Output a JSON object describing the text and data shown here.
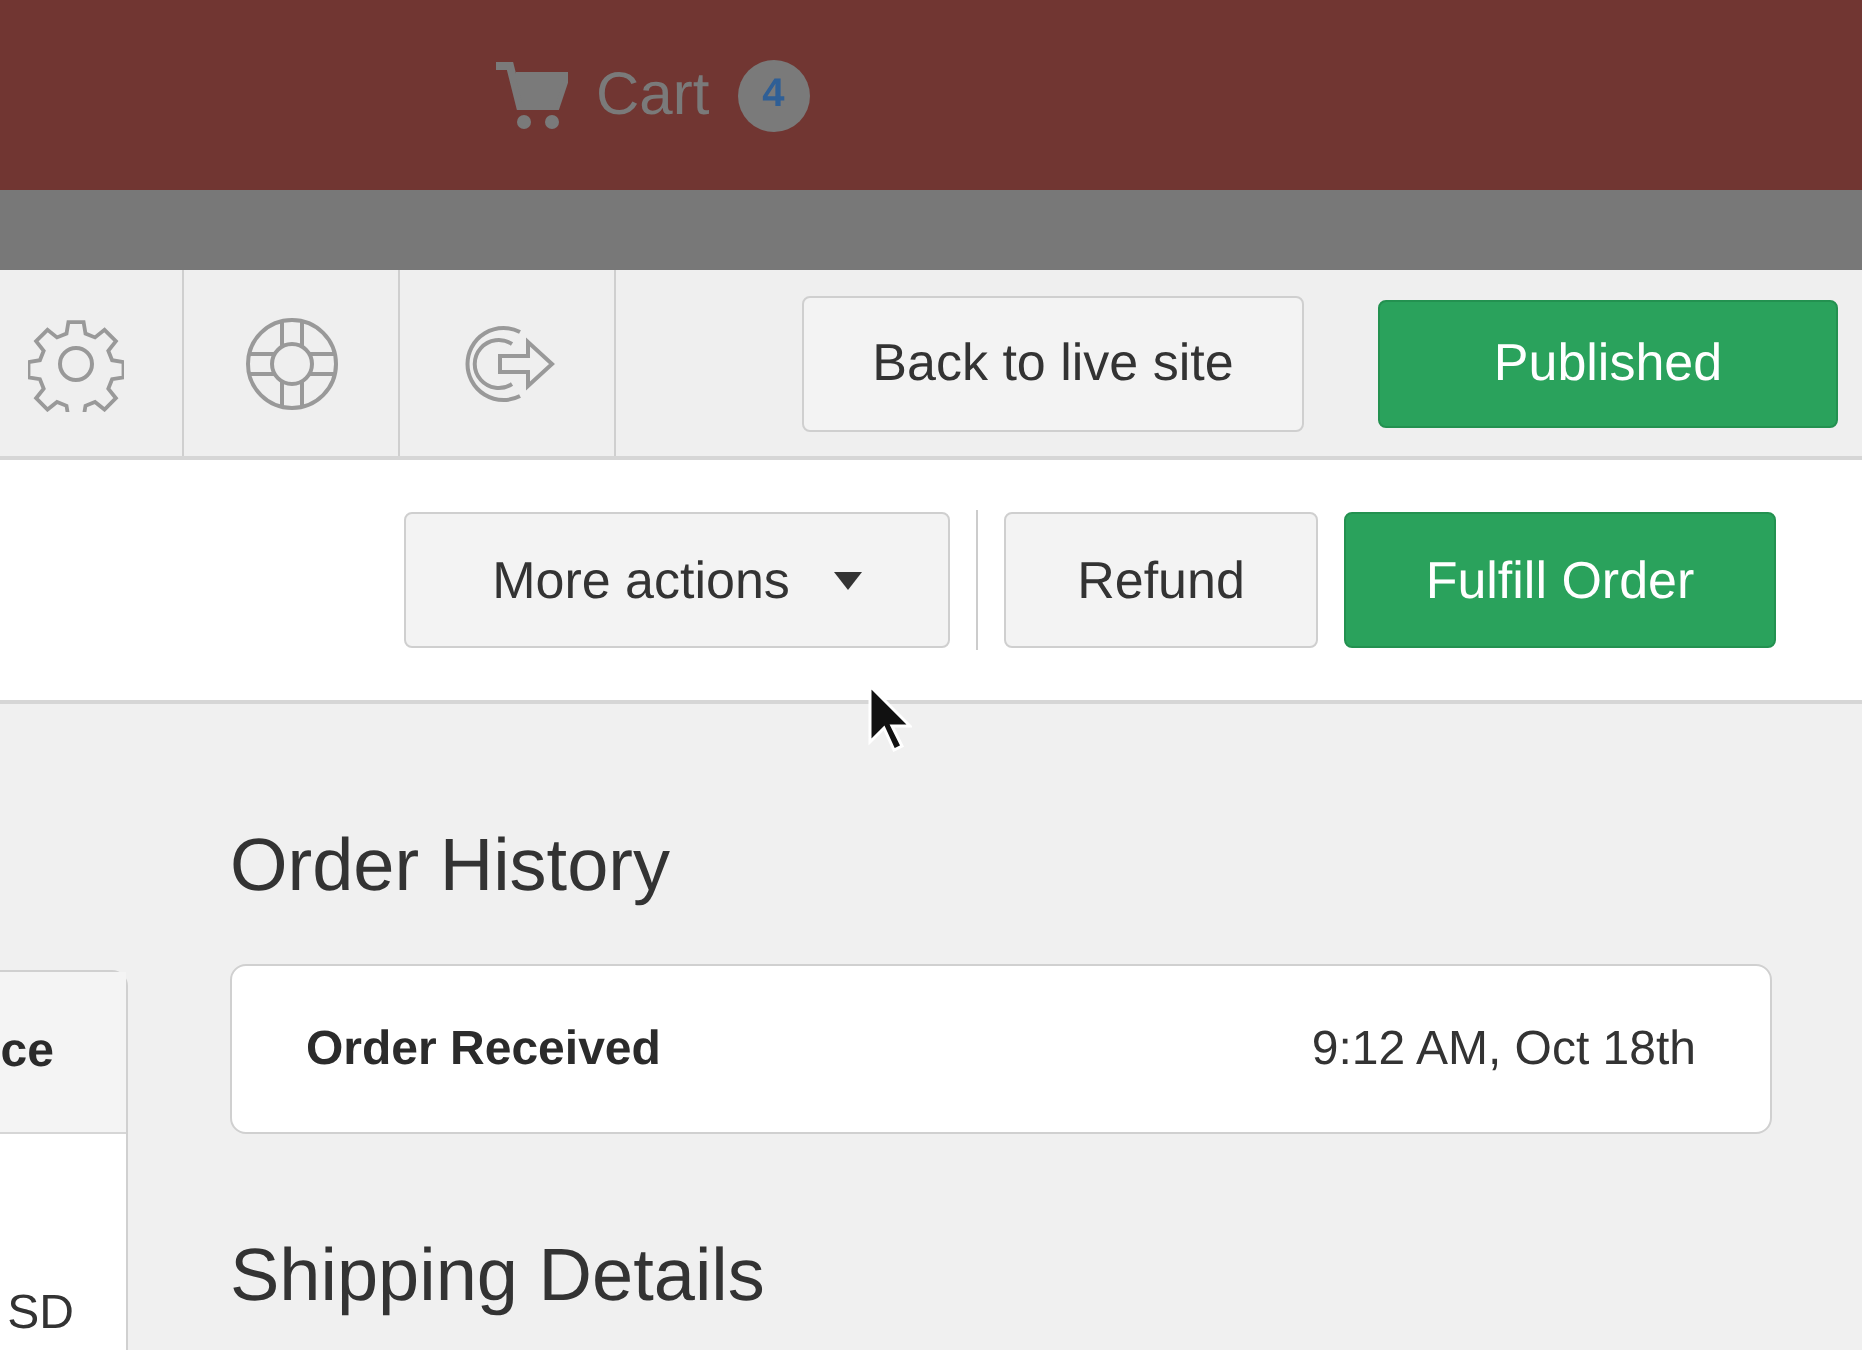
{
  "top_nav": {
    "cart_label": "Cart",
    "cart_count": "4"
  },
  "toolbar": {
    "buttons": [
      {
        "label": "Back to live site",
        "kind": "secondary"
      },
      {
        "label": "Published",
        "kind": "primary"
      }
    ]
  },
  "actions": [
    {
      "label": "More actions",
      "kind": "dropdown"
    },
    {
      "label": "Refund",
      "kind": "secondary"
    },
    {
      "label": "Fulfill Order",
      "kind": "primary"
    }
  ],
  "line_items": {
    "column_header": "ce",
    "cell": "SD"
  },
  "order_history": {
    "title": "Order History",
    "events": [
      {
        "label": "Order Received",
        "time": "9:12 AM, Oct 18th"
      }
    ]
  },
  "shipping_details": {
    "title": "Shipping Details"
  }
}
